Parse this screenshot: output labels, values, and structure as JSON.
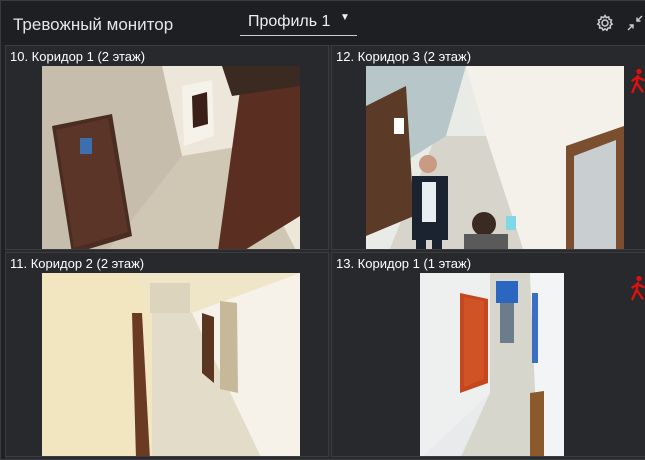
{
  "window": {
    "title": "Тревожный монитор"
  },
  "profile": {
    "label": "Профиль 1"
  },
  "icons": {
    "settings": "gear-icon",
    "collapse": "collapse-icon",
    "alarm": "walking-person-icon",
    "dropdown": "caret-down-icon"
  },
  "colors": {
    "background": "#202124",
    "alarm": "#e01010",
    "text": "#ffffff"
  },
  "cameras": [
    {
      "title": "10. Коридор 1 (2 этаж)",
      "alarm": false
    },
    {
      "title": "12. Коридор 3 (2 этаж)",
      "alarm": true
    },
    {
      "title": "11. Коридор 2 (2 этаж)",
      "alarm": false
    },
    {
      "title": "13. Коридор 1 (1 этаж)",
      "alarm": true
    }
  ]
}
